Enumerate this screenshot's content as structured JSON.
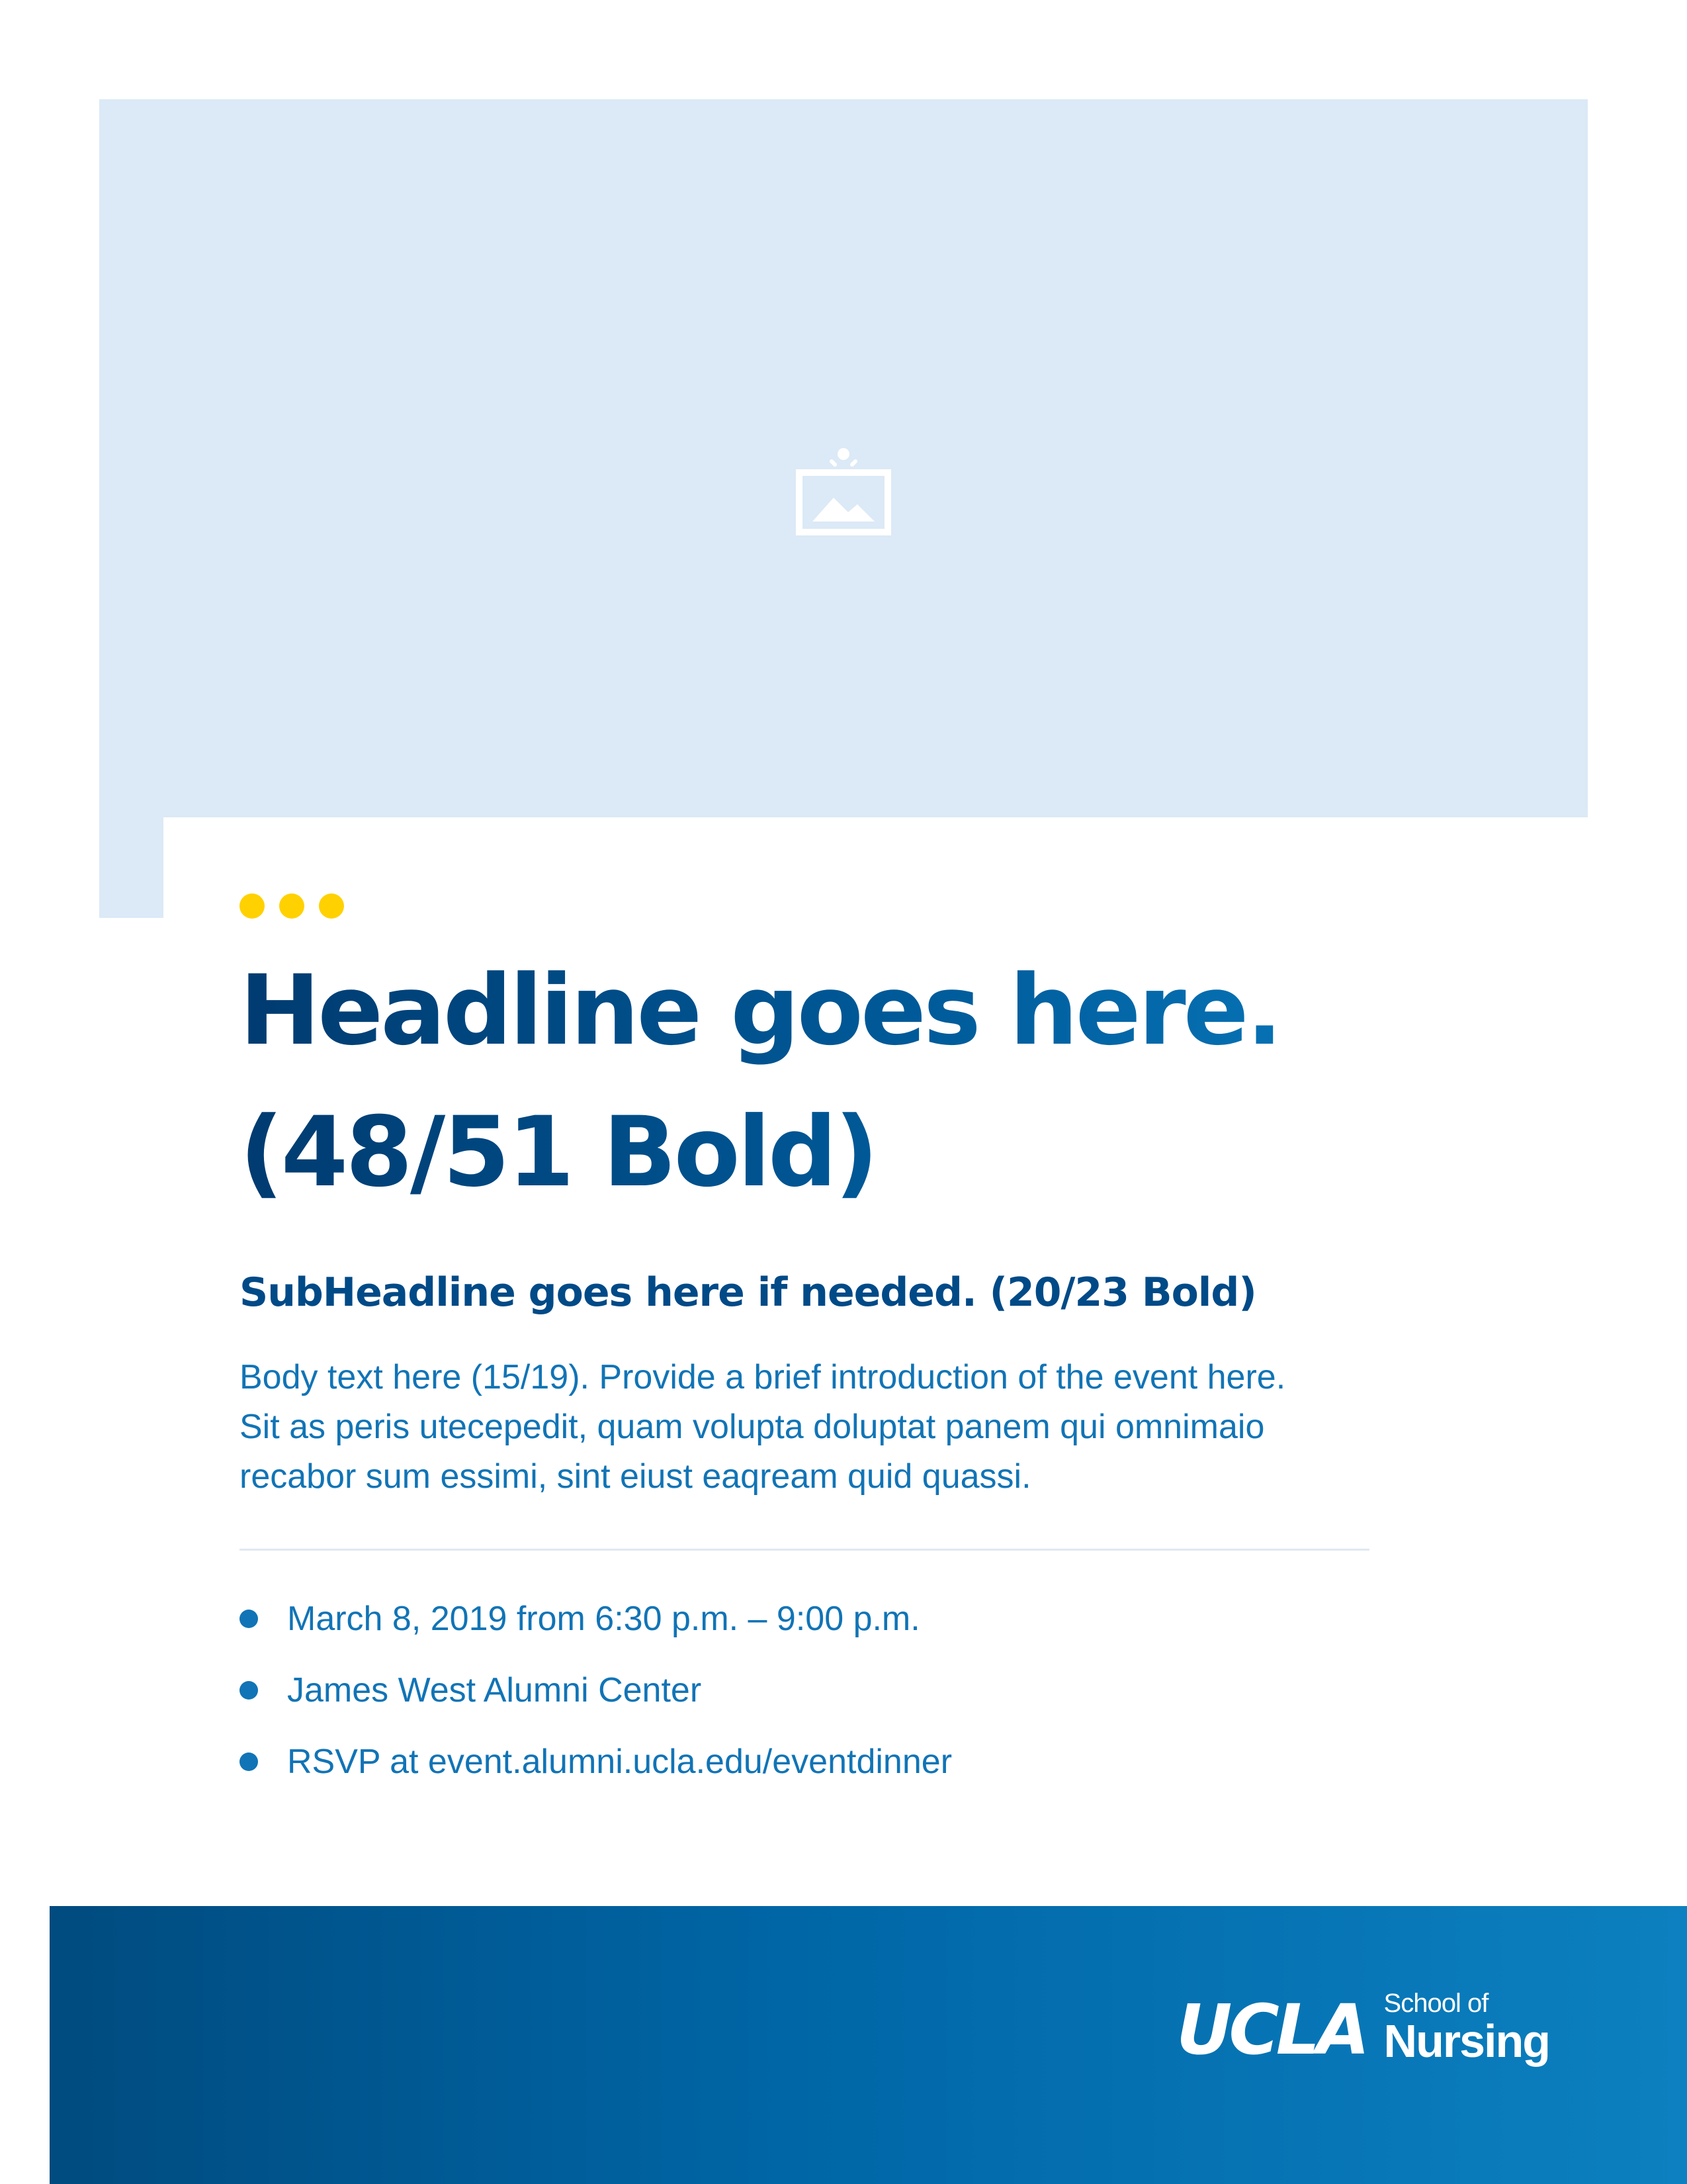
{
  "image_placeholder": {
    "icon": "image-placeholder-icon",
    "background_color": "#dce9f6"
  },
  "accent": {
    "dot_color": "#ffd100",
    "dot_count": 3
  },
  "headline": {
    "line1": "Headline goes here.",
    "line2": "(48/51 Bold)",
    "color_start": "#003b70",
    "color_end": "#0a7ec2"
  },
  "subheadline": "SubHeadline goes here if needed. (20/23 Bold)",
  "body": {
    "lines": [
      "Body text here (15/19). Provide a brief introduction of the event here.",
      "Sit as peris utecepedit, quam volupta doluptat panem qui omnimaio",
      "recabor sum essimi, sint eiust eaqream quid quassi."
    ],
    "color": "#1174b6"
  },
  "details": [
    "March 8, 2019 from 6:30 p.m. – 9:00 p.m.",
    "James West Alumni Center",
    "RSVP at event.alumni.ucla.edu/eventdinner"
  ],
  "footer": {
    "logo_mark": "UCLA",
    "school_line1": "School of",
    "school_line2": "Nursing",
    "gradient_start": "#004b7f",
    "gradient_end": "#0c80c0"
  }
}
